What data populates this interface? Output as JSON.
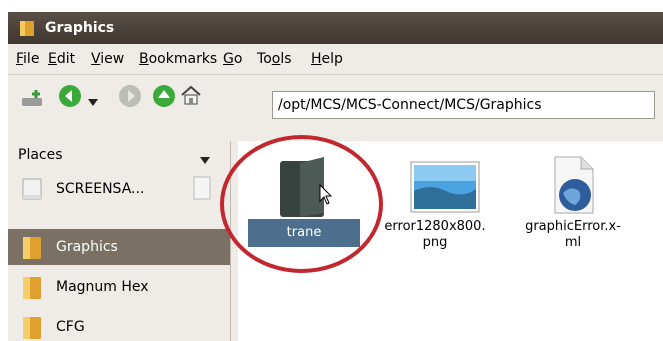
{
  "window": {
    "title": "Graphics"
  },
  "menu": {
    "file": "File",
    "edit": "Edit",
    "view": "View",
    "bookmarks": "Bookmarks",
    "go": "Go",
    "tools_pre": "To",
    "tools_u": "o",
    "tools_post": "ls",
    "help": "Help"
  },
  "toolbar": {
    "path": "/opt/MCS/MCS-Connect/MCS/Graphics"
  },
  "sidebar": {
    "header": "Places",
    "items": [
      {
        "label": "SCREENSA...",
        "icon": "drive-icon"
      },
      {
        "label": "Graphics",
        "icon": "folder-icon",
        "selected": true
      },
      {
        "label": "Magnum Hex",
        "icon": "folder-icon"
      },
      {
        "label": "CFG",
        "icon": "folder-icon"
      }
    ]
  },
  "files": [
    {
      "name": "trane",
      "icon": "folder-icon",
      "selected": true
    },
    {
      "name_line1": "error1280x800.",
      "name_line2": "png",
      "icon": "image-icon"
    },
    {
      "name_line1": "graphicError.x-",
      "name_line2": "ml",
      "icon": "xml-globe-icon"
    }
  ],
  "colors": {
    "highlight_circle": "#c1272d",
    "selection": "#4d6e8c",
    "sidebar_selection": "#7a7164"
  }
}
